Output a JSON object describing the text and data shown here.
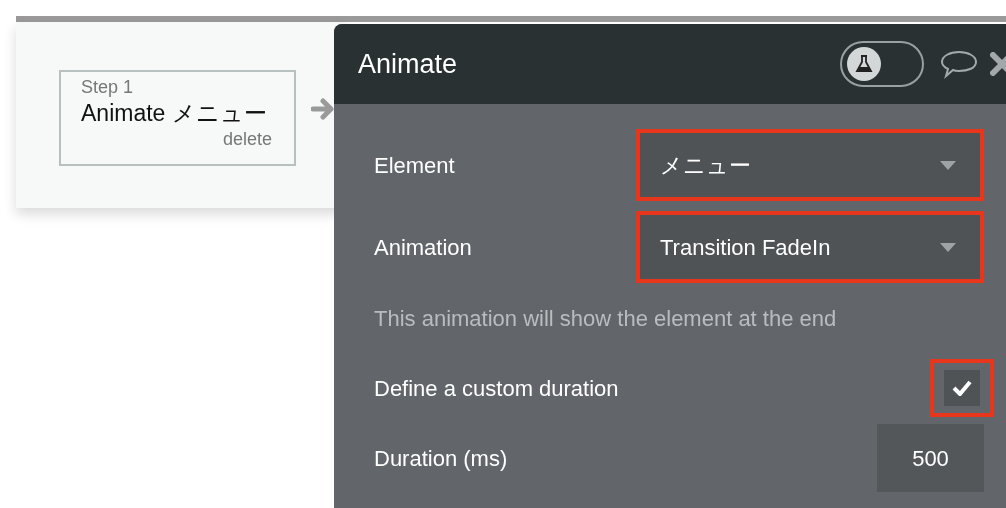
{
  "step": {
    "label": "Step 1",
    "title": "Animate メニュー",
    "delete": "delete"
  },
  "panel": {
    "title": "Animate",
    "test_toggle": {
      "on": false
    },
    "fields": [
      {
        "kind": "dropdown",
        "label": "Element",
        "value": "メニュー",
        "highlighted": true
      },
      {
        "kind": "dropdown",
        "label": "Animation",
        "value": "Transition FadeIn",
        "highlighted": true
      },
      {
        "kind": "note",
        "label": "This animation will show the element at the end"
      },
      {
        "kind": "checkbox",
        "label": "Define a custom duration",
        "checked": true,
        "highlighted": true
      },
      {
        "kind": "number",
        "label": "Duration (ms)",
        "value": "500",
        "highlighted": false
      }
    ]
  }
}
